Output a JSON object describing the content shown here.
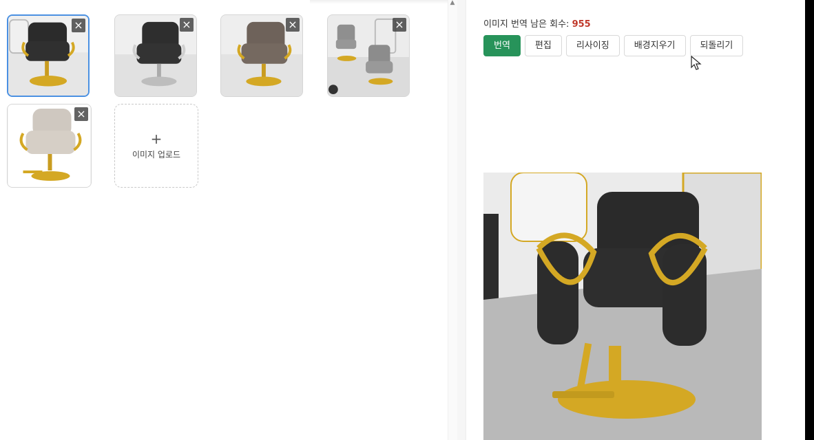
{
  "thumbnails": [
    {
      "name": "thumb-black-chair",
      "close": "×",
      "selected": true
    },
    {
      "name": "thumb-black-chair-alt",
      "close": "×",
      "selected": false
    },
    {
      "name": "thumb-brown-chair",
      "close": "×",
      "selected": false
    },
    {
      "name": "thumb-salon-gray-chairs",
      "close": "×",
      "selected": false
    },
    {
      "name": "thumb-cream-chair",
      "close": "×",
      "selected": false
    }
  ],
  "upload": {
    "plus": "+",
    "label": "이미지 업로드"
  },
  "quota": {
    "label": "이미지 번역 남은 회수:",
    "count": "955"
  },
  "toolbar": {
    "translate_label": "번역",
    "edit_label": "편집",
    "resize_label": "리사이징",
    "remove_bg_label": "배경지우기",
    "undo_label": "되돌리기"
  },
  "scroll_up_glyph": "▲",
  "colors": {
    "primary": "#27935a",
    "count": "#c0392b",
    "selected_border": "#4a90e2",
    "gold": "#d4a824"
  }
}
